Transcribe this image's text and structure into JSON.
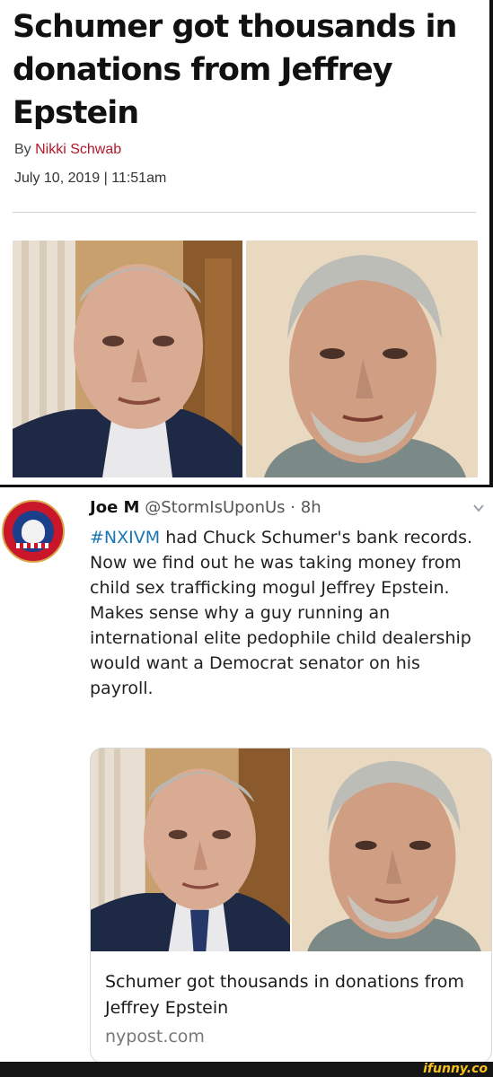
{
  "article": {
    "headline": "Schumer got thousands in donations from Jeffrey Epstein",
    "byline_prefix": "By ",
    "author": "Nikki Schwab",
    "date": "July 10, 2019 | 11:51am"
  },
  "tweet": {
    "name": "Joe M",
    "handle": "@StormIsUponUs",
    "separator": "·",
    "time": "8h",
    "hashtag": "#NXIVM",
    "text": " had Chuck Schumer's bank records. Now we find out he was taking money from child sex trafficking mogul Jeffrey Epstein. Makes sense why a guy running an international elite pedophile child dealership would want a Democrat senator on his payroll.",
    "card": {
      "title": "Schumer got thousands in donations from Jeffrey Epstein",
      "domain": "nypost.com"
    }
  },
  "watermark": "ifunny.co",
  "colors": {
    "author_red": "#b3172a",
    "hashtag_blue": "#1b76b4",
    "watermark_yellow": "#f7c21e"
  },
  "icons": {
    "chevron": "chevron-down-icon",
    "avatar": "punisher-badge-avatar"
  }
}
